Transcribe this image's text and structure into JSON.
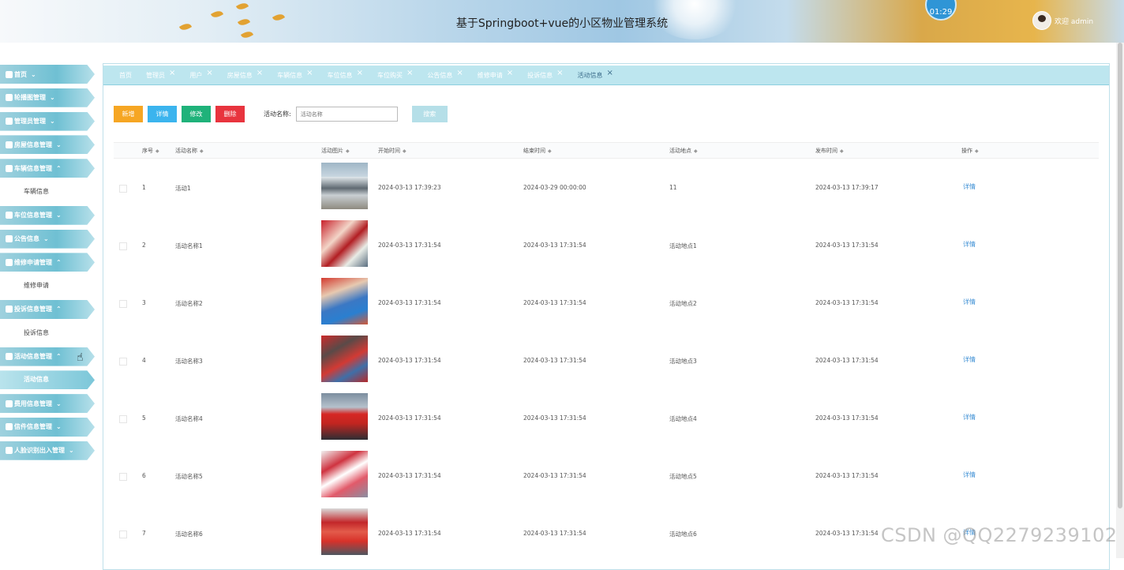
{
  "header": {
    "title": "基于Springboot+vue的小区物业管理系统",
    "clock": "01:29",
    "welcome": "欢迎 admin"
  },
  "sidebar": {
    "items": [
      {
        "label": "首页",
        "expanded": false
      },
      {
        "label": "轮播图管理",
        "expanded": false
      },
      {
        "label": "管理员管理",
        "expanded": false
      },
      {
        "label": "房屋信息管理",
        "expanded": false
      },
      {
        "label": "车辆信息管理",
        "expanded": true
      },
      {
        "label": "车辆信息",
        "sub": true
      },
      {
        "label": "车位信息管理",
        "expanded": false
      },
      {
        "label": "公告信息",
        "expanded": false
      },
      {
        "label": "维修申请管理",
        "expanded": true
      },
      {
        "label": "维修申请",
        "sub": true
      },
      {
        "label": "投诉信息管理",
        "expanded": true
      },
      {
        "label": "投诉信息",
        "sub": true
      },
      {
        "label": "活动信息管理",
        "expanded": true
      },
      {
        "label": "活动信息",
        "sub": true,
        "active": true
      },
      {
        "label": "费用信息管理",
        "expanded": false
      },
      {
        "label": "信件信息管理",
        "expanded": false
      },
      {
        "label": "人脸识别出入管理",
        "expanded": false
      }
    ]
  },
  "tabs": [
    "首页",
    "管理员",
    "用户",
    "房屋信息",
    "车辆信息",
    "车位信息",
    "车位购买",
    "公告信息",
    "维修申请",
    "投诉信息",
    "活动信息"
  ],
  "active_tab": "活动信息",
  "toolbar": {
    "add": "新增",
    "detail": "详情",
    "edit": "修改",
    "delete": "删除",
    "search_label": "活动名称:",
    "search_placeholder": "活动名称",
    "search_button": "搜索",
    "colors": {
      "add": "#f6a623",
      "detail": "#3bb4ee",
      "edit": "#1fb27a",
      "delete": "#e8343e"
    }
  },
  "table": {
    "columns": [
      "序号",
      "活动名称",
      "活动图片",
      "开始时间",
      "结束时间",
      "活动地点",
      "发布时间",
      "操作"
    ],
    "rows": [
      {
        "no": "1",
        "name": "活动1",
        "start": "2024-03-13 17:39:23",
        "end": "2024-03-29 00:00:00",
        "place": "11",
        "publish": "2024-03-13 17:39:17",
        "action": "详情"
      },
      {
        "no": "2",
        "name": "活动名称1",
        "start": "2024-03-13 17:31:54",
        "end": "2024-03-13 17:31:54",
        "place": "活动地点1",
        "publish": "2024-03-13 17:31:54",
        "action": "详情"
      },
      {
        "no": "3",
        "name": "活动名称2",
        "start": "2024-03-13 17:31:54",
        "end": "2024-03-13 17:31:54",
        "place": "活动地点2",
        "publish": "2024-03-13 17:31:54",
        "action": "详情"
      },
      {
        "no": "4",
        "name": "活动名称3",
        "start": "2024-03-13 17:31:54",
        "end": "2024-03-13 17:31:54",
        "place": "活动地点3",
        "publish": "2024-03-13 17:31:54",
        "action": "详情"
      },
      {
        "no": "5",
        "name": "活动名称4",
        "start": "2024-03-13 17:31:54",
        "end": "2024-03-13 17:31:54",
        "place": "活动地点4",
        "publish": "2024-03-13 17:31:54",
        "action": "详情"
      },
      {
        "no": "6",
        "name": "活动名称5",
        "start": "2024-03-13 17:31:54",
        "end": "2024-03-13 17:31:54",
        "place": "活动地点5",
        "publish": "2024-03-13 17:31:54",
        "action": "详情"
      },
      {
        "no": "7",
        "name": "活动名称6",
        "start": "2024-03-13 17:31:54",
        "end": "2024-03-13 17:31:54",
        "place": "活动地点6",
        "publish": "2024-03-13 17:31:54",
        "action": "详情"
      }
    ]
  },
  "watermark": "CSDN @QQ2279239102"
}
